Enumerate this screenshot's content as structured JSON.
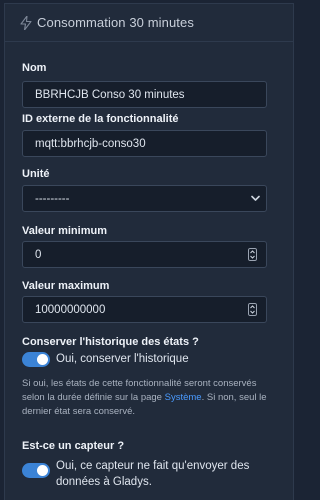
{
  "header": {
    "title": "Consommation 30 minutes",
    "icon": "flash-icon"
  },
  "form": {
    "name_label": "Nom",
    "name_value": "BBRHCJB Conso 30 minutes",
    "external_id_label": "ID externe de la fonctionnalité",
    "external_id_value": "mqtt:bbrhcjb-conso30",
    "unit_label": "Unité",
    "unit_value": "---------",
    "min_label": "Valeur minimum",
    "min_value": "0",
    "max_label": "Valeur maximum",
    "max_value": "10000000000",
    "history_label": "Conserver l'historique des états ?",
    "history_toggle_label": "Oui, conserver l'historique",
    "history_toggle_on": true,
    "history_help_before": "Si oui, les états de cette fonctionnalité seront conservés selon la durée définie sur la page ",
    "history_help_link": "Système",
    "history_help_after": ". Si non, seul le dernier état sera conservé.",
    "sensor_label": "Est-ce un capteur ?",
    "sensor_toggle_label": "Oui, ce capteur ne fait qu'envoyer des données à Gladys.",
    "sensor_toggle_on": true
  },
  "colors": {
    "background": "#1b2434",
    "card": "#212b3b",
    "input_bg": "#161e2b",
    "toggle_on": "#3b83d6",
    "link": "#4b9bff"
  }
}
